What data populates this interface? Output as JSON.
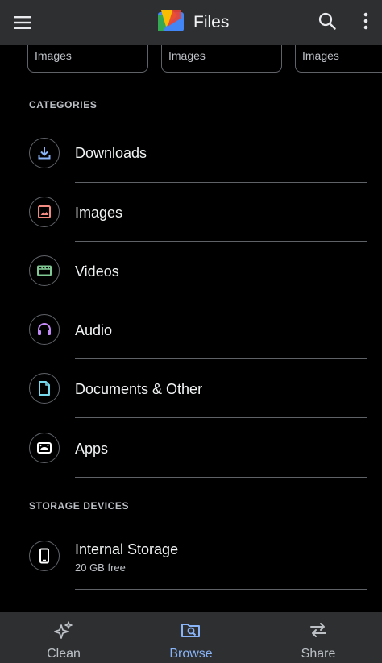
{
  "app": {
    "title": "Files"
  },
  "quick_cards": [
    {
      "label": "Images"
    },
    {
      "label": "Images"
    },
    {
      "label": "Images"
    }
  ],
  "categories": {
    "header": "CATEGORIES",
    "items": [
      {
        "label": "Downloads",
        "icon": "download-icon",
        "color": "#8ab4f8"
      },
      {
        "label": "Images",
        "icon": "image-icon",
        "color": "#f28b82"
      },
      {
        "label": "Videos",
        "icon": "video-icon",
        "color": "#81c995"
      },
      {
        "label": "Audio",
        "icon": "headphones-icon",
        "color": "#c58af9"
      },
      {
        "label": "Documents & Other",
        "icon": "document-icon",
        "color": "#78d9ec"
      },
      {
        "label": "Apps",
        "icon": "android-icon",
        "color": "#ffffff"
      }
    ]
  },
  "storage": {
    "header": "STORAGE DEVICES",
    "items": [
      {
        "label": "Internal Storage",
        "subtitle": "20 GB free",
        "icon": "phone-icon",
        "color": "#ffffff"
      }
    ]
  },
  "bottom_nav": {
    "active": "Browse",
    "active_color": "#8ab4f8",
    "items": [
      {
        "label": "Clean",
        "icon": "sparkle-icon"
      },
      {
        "label": "Browse",
        "icon": "browse-icon"
      },
      {
        "label": "Share",
        "icon": "swap-icon"
      }
    ]
  }
}
